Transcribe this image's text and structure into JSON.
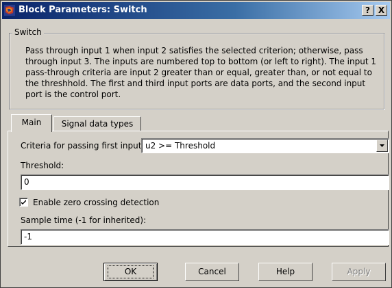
{
  "window": {
    "title": "Block Parameters: Switch",
    "help_glyph": "?",
    "close_glyph": "X"
  },
  "group": {
    "label": "Switch",
    "description": "Pass through input 1 when input 2 satisfies the selected criterion; otherwise, pass through input 3.  The inputs are numbered top to bottom (or left to right). The input 1 pass-through criteria are input 2 greater than or equal, greater than, or not equal to the threshhold.  The first and third input ports are data ports, and the second input port is the control port."
  },
  "tabs": [
    {
      "label": "Main",
      "selected": true
    },
    {
      "label": "Signal data types",
      "selected": false
    }
  ],
  "main": {
    "criteria_label": "Criteria for passing first input:",
    "criteria_value": "u2 >= Threshold",
    "threshold_label": "Threshold:",
    "threshold_value": "0",
    "zero_crossing_label": "Enable zero crossing detection",
    "zero_crossing_checked": true,
    "sample_time_label": "Sample time (-1 for inherited):",
    "sample_time_value": "-1"
  },
  "buttons": {
    "ok": "OK",
    "cancel": "Cancel",
    "help": "Help",
    "apply": "Apply",
    "apply_enabled": false
  },
  "colors": {
    "title_active": "#0a246a",
    "title_gradient_end": "#a6caf0",
    "face": "#d4d0c8"
  },
  "icons": {
    "title": "simulink-block-icon",
    "dropdown": "chevron-down-icon",
    "check": "checkmark-icon"
  }
}
